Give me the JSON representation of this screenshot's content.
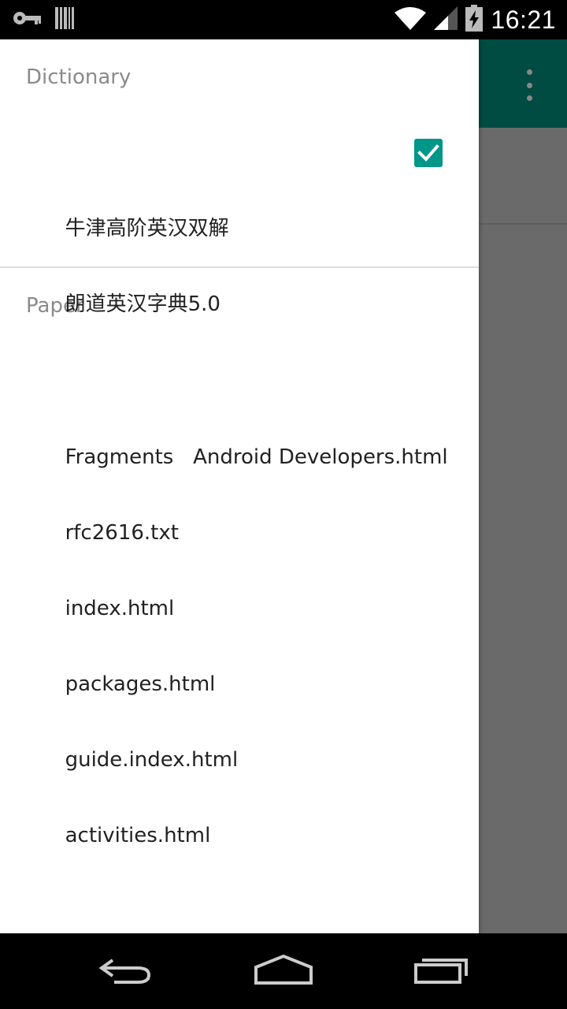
{
  "status_bar": {
    "time": "16:21",
    "icons": [
      "vpn-key-icon",
      "barcode-icon",
      "wifi-icon",
      "signal-icon",
      "battery-charging-icon"
    ]
  },
  "background_app": {
    "toolbar_color": "#004b42",
    "overflow_icon": "overflow-menu-icon"
  },
  "drawer": {
    "sections": [
      {
        "header": "Dictionary",
        "items": [
          {
            "label": "牛津高阶英汉双解",
            "checked": true
          },
          {
            "label": "朗道英汉字典5.0",
            "checked": false
          }
        ]
      },
      {
        "header": "Paper",
        "items": [
          {
            "label": "Fragments   Android Developers.html"
          },
          {
            "label": "rfc2616.txt"
          },
          {
            "label": "index.html"
          },
          {
            "label": "packages.html"
          },
          {
            "label": "guide.index.html"
          },
          {
            "label": "activities.html"
          }
        ]
      }
    ]
  },
  "nav_bar": {
    "buttons": [
      "back-icon",
      "home-icon",
      "recents-icon"
    ]
  },
  "colors": {
    "accent": "#009688",
    "scrim": "#6a6a6a"
  }
}
